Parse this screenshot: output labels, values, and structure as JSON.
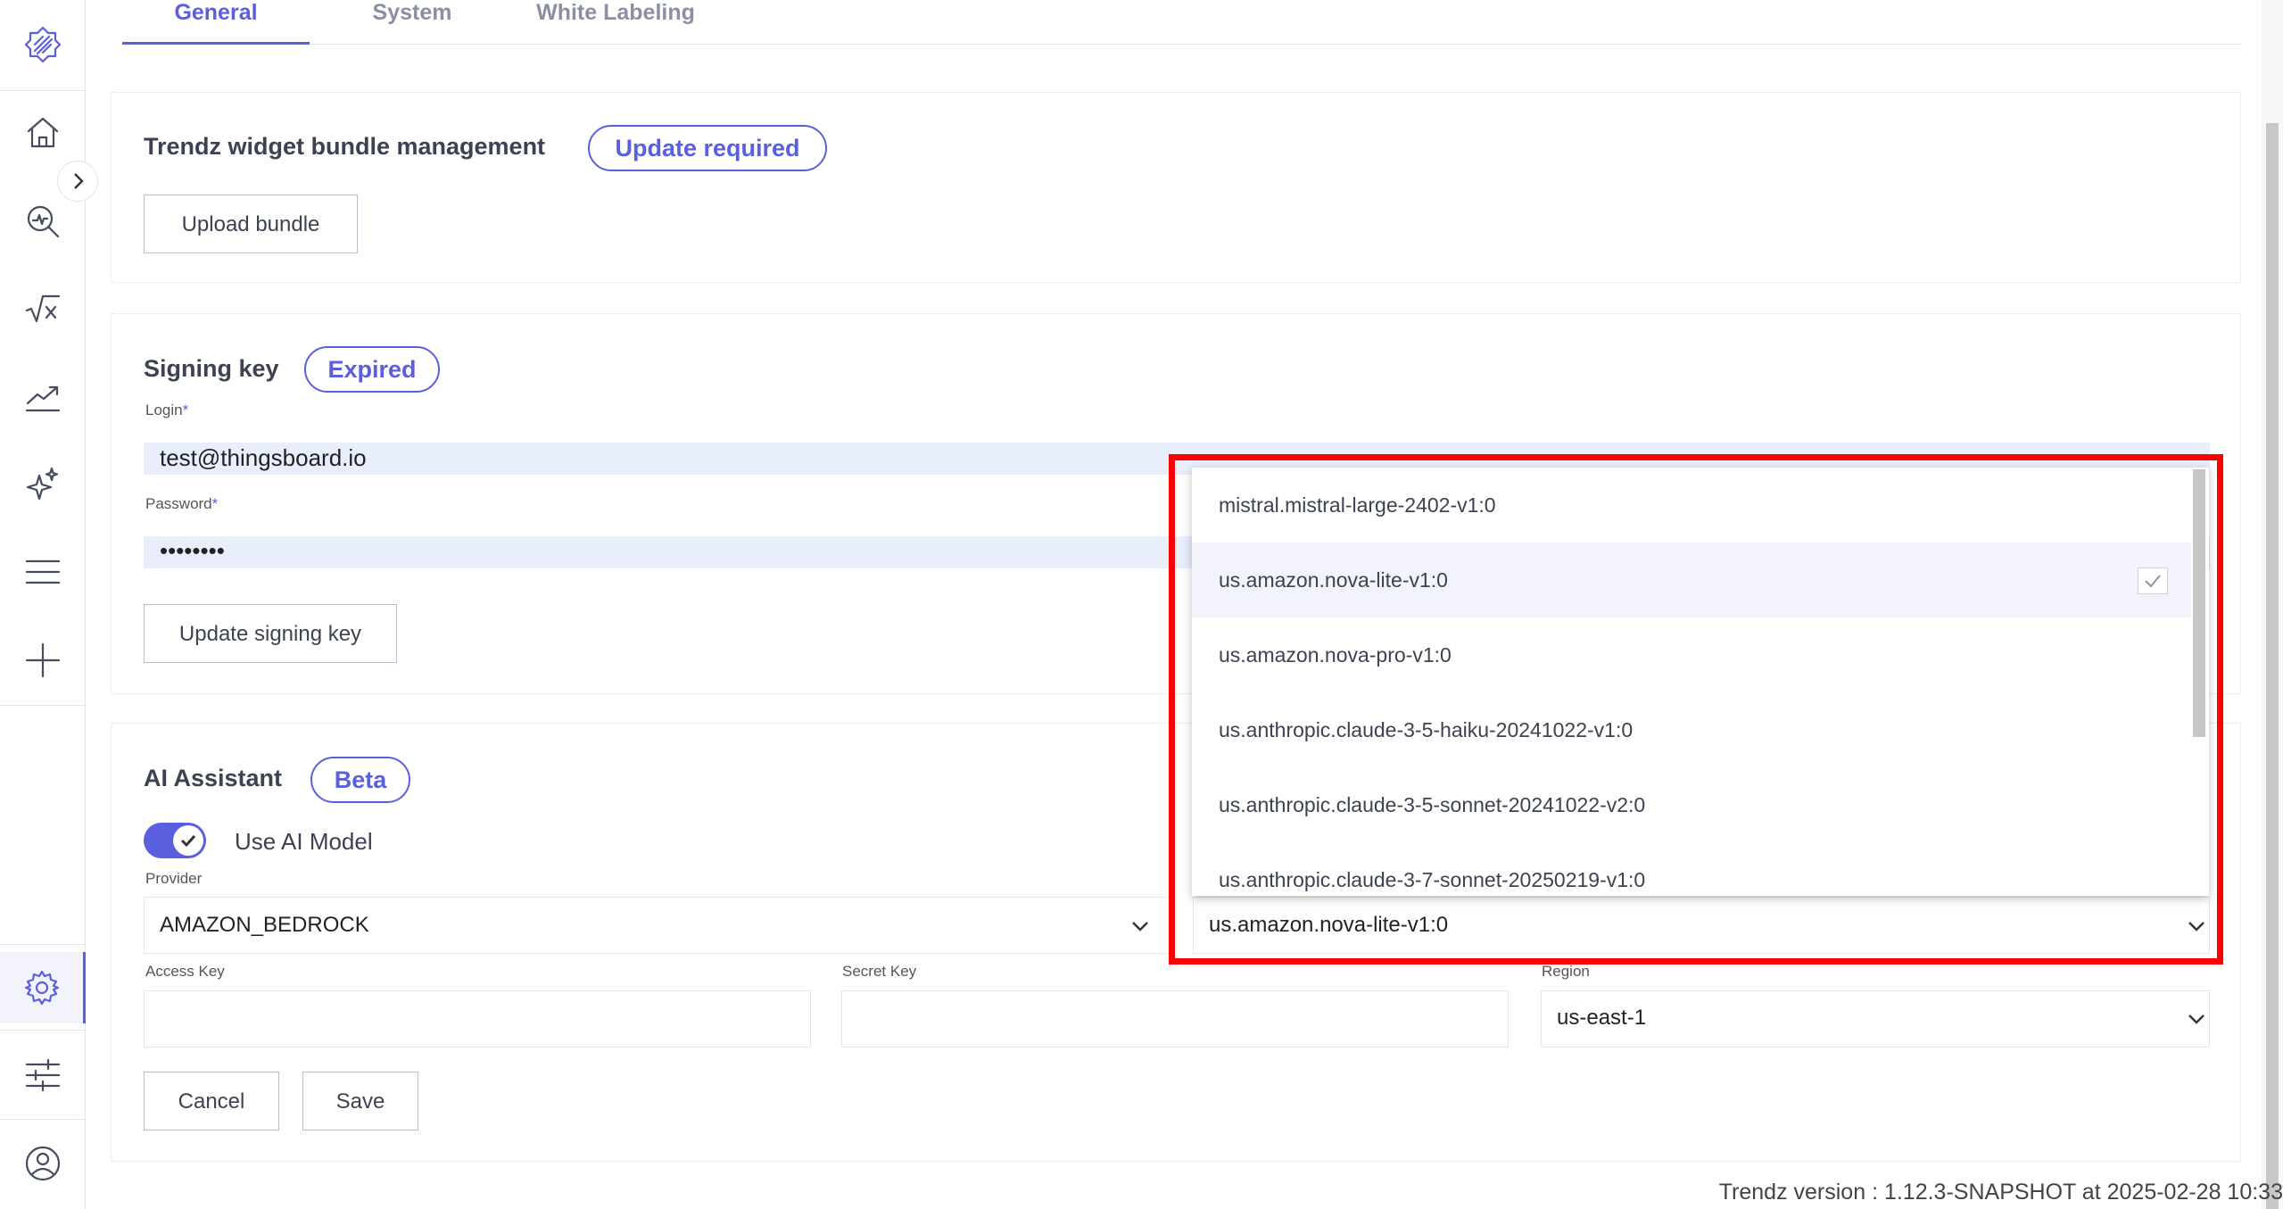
{
  "tabs": [
    {
      "label": "General"
    },
    {
      "label": "System"
    },
    {
      "label": "White Labeling"
    }
  ],
  "bundle_card": {
    "title": "Trendz widget bundle management",
    "badge": "Update required",
    "upload_label": "Upload bundle"
  },
  "signing_card": {
    "title": "Signing key",
    "badge": "Expired",
    "login_label": "Login",
    "login_value": "test@thingsboard.io",
    "password_label": "Password",
    "password_value": "••••••••",
    "required_mark": "*",
    "update_label": "Update signing key"
  },
  "ai_card": {
    "title": "AI Assistant",
    "badge": "Beta",
    "toggle_label": "Use AI Model",
    "toggle_on": true,
    "provider_label": "Provider",
    "provider_value": "AMAZON_BEDROCK",
    "model_value": "us.amazon.nova-lite-v1:0",
    "access_key_label": "Access Key",
    "secret_key_label": "Secret Key",
    "region_label": "Region",
    "region_value": "us-east-1",
    "cancel_label": "Cancel",
    "save_label": "Save"
  },
  "model_dropdown": {
    "options": [
      {
        "label": "mistral.mistral-large-2402-v1:0",
        "selected": false
      },
      {
        "label": "us.amazon.nova-lite-v1:0",
        "selected": true
      },
      {
        "label": "us.amazon.nova-pro-v1:0",
        "selected": false
      },
      {
        "label": "us.anthropic.claude-3-5-haiku-20241022-v1:0",
        "selected": false
      },
      {
        "label": "us.anthropic.claude-3-5-sonnet-20241022-v2:0",
        "selected": false
      },
      {
        "label": "us.anthropic.claude-3-7-sonnet-20250219-v1:0",
        "selected": false
      }
    ]
  },
  "sidebar": {
    "items": [
      {
        "icon": "logo-icon"
      },
      {
        "icon": "home-icon"
      },
      {
        "icon": "explore-icon"
      },
      {
        "icon": "calculation-icon"
      },
      {
        "icon": "trend-icon"
      },
      {
        "icon": "ai-sparkle-icon"
      },
      {
        "icon": "menu-icon"
      },
      {
        "icon": "add-icon"
      },
      {
        "icon": "settings-icon"
      },
      {
        "icon": "sliders-icon"
      },
      {
        "icon": "account-icon"
      }
    ]
  },
  "footer": {
    "version": "Trendz version : 1.12.3-SNAPSHOT at 2025-02-28 10:33"
  },
  "colors": {
    "accent": "#5a5fe0",
    "highlight": "#ff0000",
    "input_fill": "#e8eefc"
  }
}
